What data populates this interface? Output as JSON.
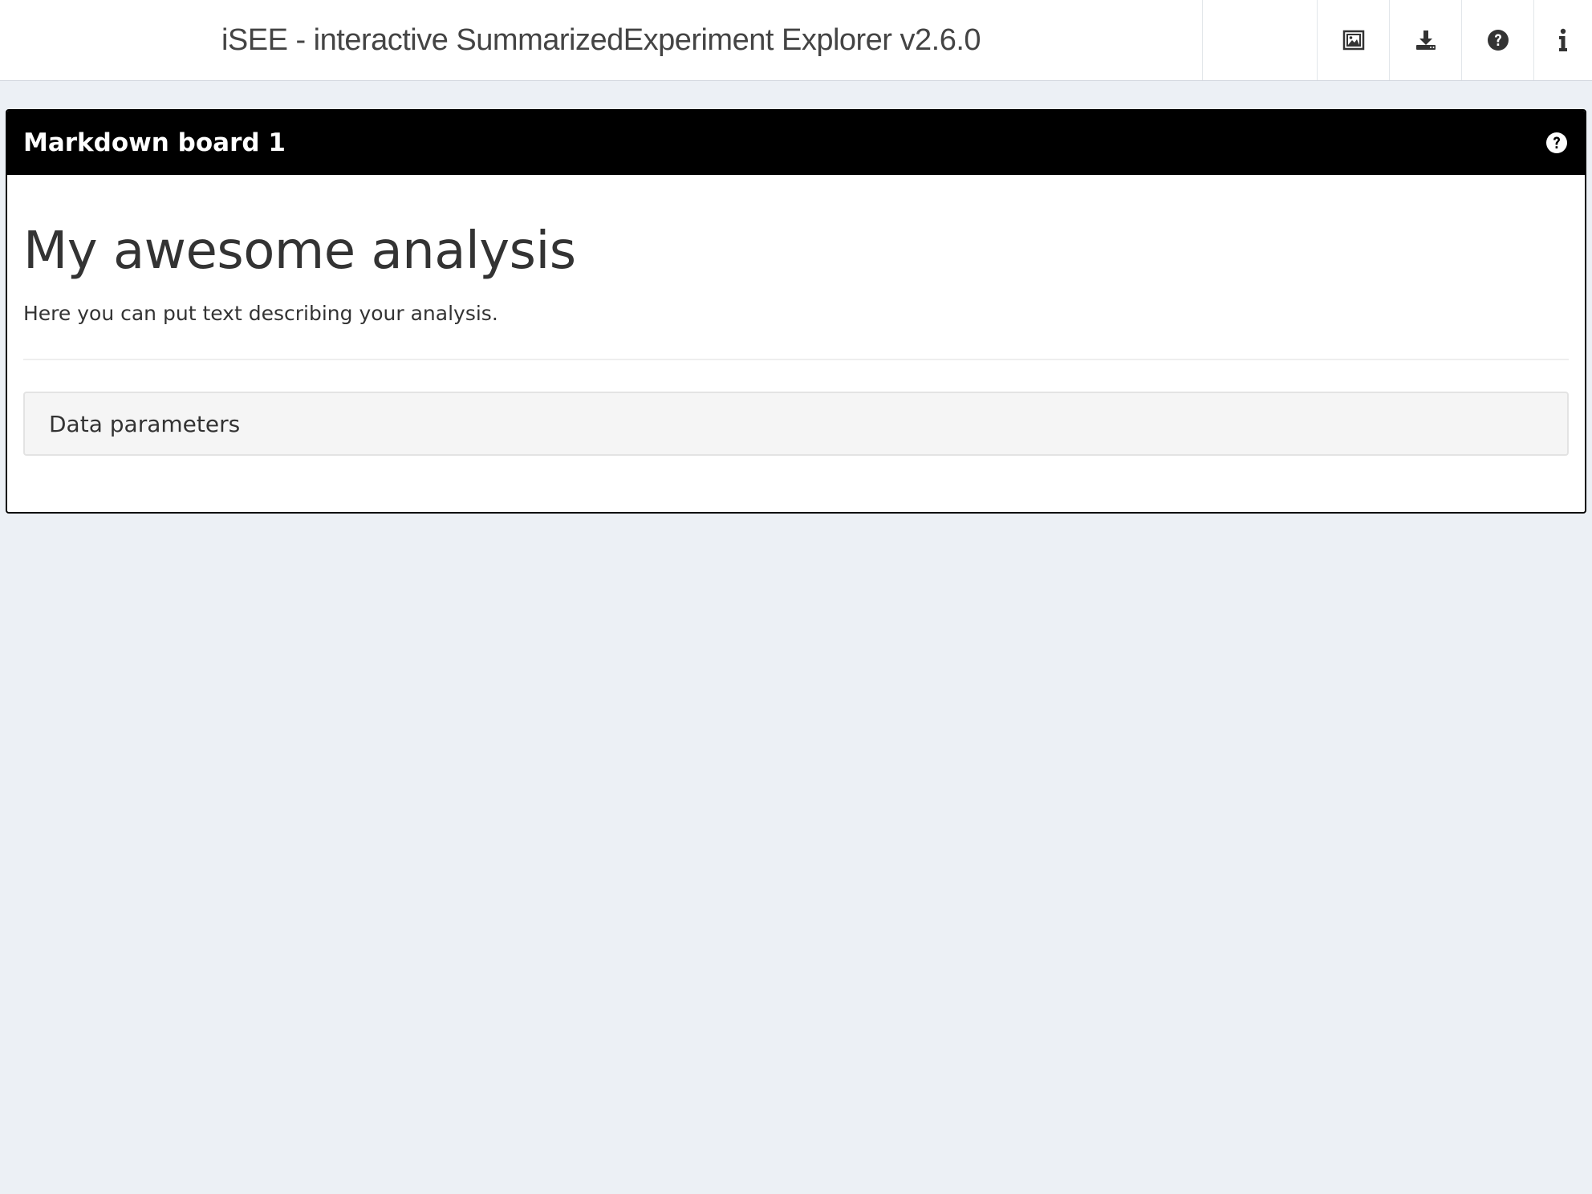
{
  "header": {
    "title": "iSEE - interactive SummarizedExperiment Explorer v2.6.0",
    "icons": [
      "image-gallery-icon",
      "download-icon",
      "question-circle-icon",
      "info-icon"
    ]
  },
  "panel": {
    "title": "Markdown board 1",
    "header_color": "#000000",
    "help_icon": "question-circle-icon",
    "content": {
      "heading": "My awesome analysis",
      "paragraph": "Here you can put text describing your analysis."
    },
    "collapse": {
      "label": "Data parameters"
    }
  },
  "colors": {
    "background": "#ecf0f5",
    "header_bg": "#ffffff",
    "panel_border": "#000000"
  }
}
